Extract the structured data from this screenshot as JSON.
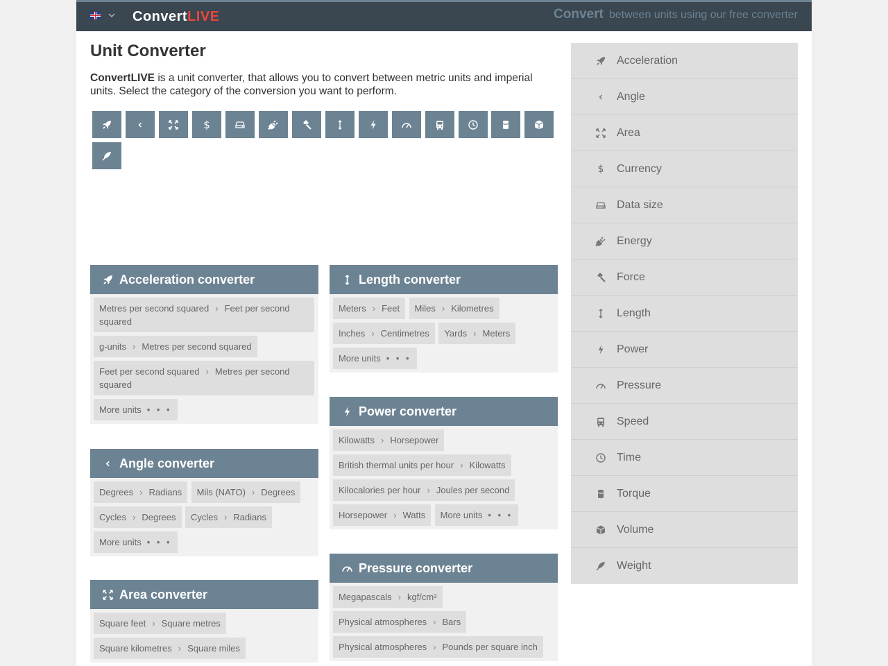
{
  "header": {
    "logo_main": "Convert",
    "logo_accent": "LIVE",
    "tagline_bold": "Convert",
    "tagline_rest": "between units using our free converter"
  },
  "intro": {
    "title": "Unit Converter",
    "brand": "ConvertLIVE",
    "text": " is a unit converter, that allows you to convert between metric units and imperial units. Select the category of the conversion you want to perform."
  },
  "categories": [
    {
      "label": "Acceleration",
      "icon": "rocket-icon"
    },
    {
      "label": "Angle",
      "icon": "angle-icon"
    },
    {
      "label": "Area",
      "icon": "expand-icon"
    },
    {
      "label": "Currency",
      "icon": "dollar-icon"
    },
    {
      "label": "Data size",
      "icon": "hard-drive-icon"
    },
    {
      "label": "Energy",
      "icon": "plug-icon"
    },
    {
      "label": "Force",
      "icon": "hammer-icon"
    },
    {
      "label": "Length",
      "icon": "vertical-arrows-icon"
    },
    {
      "label": "Power",
      "icon": "bolt-icon"
    },
    {
      "label": "Pressure",
      "icon": "gauge-icon"
    },
    {
      "label": "Speed",
      "icon": "bus-icon"
    },
    {
      "label": "Time",
      "icon": "clock-icon"
    },
    {
      "label": "Torque",
      "icon": "cylinder-icon"
    },
    {
      "label": "Volume",
      "icon": "cube-icon"
    },
    {
      "label": "Weight",
      "icon": "feather-icon"
    }
  ],
  "more_units_label": "More units",
  "more_units_dots": "• • •",
  "converters": {
    "acceleration": {
      "title": "Acceleration converter",
      "links": [
        {
          "from": "Metres per second squared",
          "to": "Feet per second squared"
        },
        {
          "from": "g-units",
          "to": "Metres per second squared"
        },
        {
          "from": "Feet per second squared",
          "to": "Metres per second squared"
        }
      ]
    },
    "angle": {
      "title": "Angle converter",
      "links": [
        {
          "from": "Degrees",
          "to": "Radians"
        },
        {
          "from": "Mils (NATO)",
          "to": "Degrees"
        },
        {
          "from": "Cycles",
          "to": "Degrees"
        },
        {
          "from": "Cycles",
          "to": "Radians"
        }
      ]
    },
    "area": {
      "title": "Area converter",
      "links": [
        {
          "from": "Square feet",
          "to": "Square metres"
        },
        {
          "from": "Square kilometres",
          "to": "Square miles"
        }
      ]
    },
    "length": {
      "title": "Length converter",
      "links": [
        {
          "from": "Meters",
          "to": "Feet"
        },
        {
          "from": "Miles",
          "to": "Kilometres"
        },
        {
          "from": "Inches",
          "to": "Centimetres"
        },
        {
          "from": "Yards",
          "to": "Meters"
        }
      ]
    },
    "power": {
      "title": "Power converter",
      "links": [
        {
          "from": "Kilowatts",
          "to": "Horsepower"
        },
        {
          "from": "British thermal units per hour",
          "to": "Kilowatts"
        },
        {
          "from": "Kilocalories per hour",
          "to": "Joules per second"
        },
        {
          "from": "Horsepower",
          "to": "Watts"
        }
      ]
    },
    "pressure": {
      "title": "Pressure converter",
      "links": [
        {
          "from": "Megapascals",
          "to": "kgf/cm²"
        },
        {
          "from": "Physical atmospheres",
          "to": "Bars"
        },
        {
          "from": "Physical atmospheres",
          "to": "Pounds per square inch"
        }
      ]
    }
  }
}
